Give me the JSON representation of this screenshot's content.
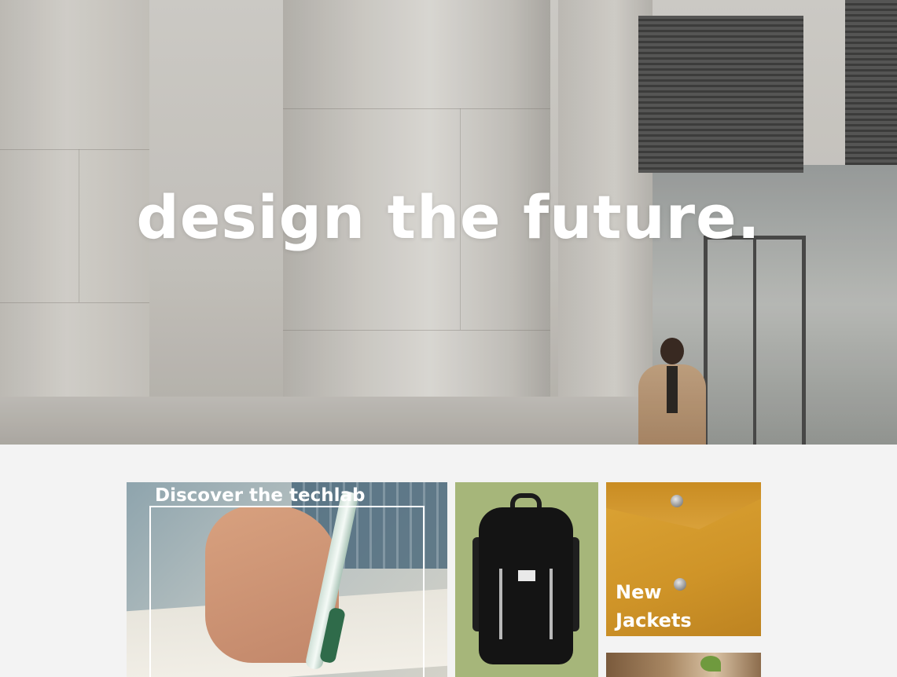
{
  "hero": {
    "title": "design the future."
  },
  "cards": {
    "techlab": {
      "title": "Discover the techlab"
    },
    "backpack": {
      "image": "black-backpack"
    },
    "jackets": {
      "title_line1": "New",
      "title_line2": "Jackets"
    },
    "garden": {
      "image": "hands-with-plant"
    }
  },
  "colors": {
    "page_background": "#f3f3f3",
    "backpack_card": "#a6b67a",
    "jackets_card": "#d69c2f",
    "text_on_image": "#ffffff"
  }
}
